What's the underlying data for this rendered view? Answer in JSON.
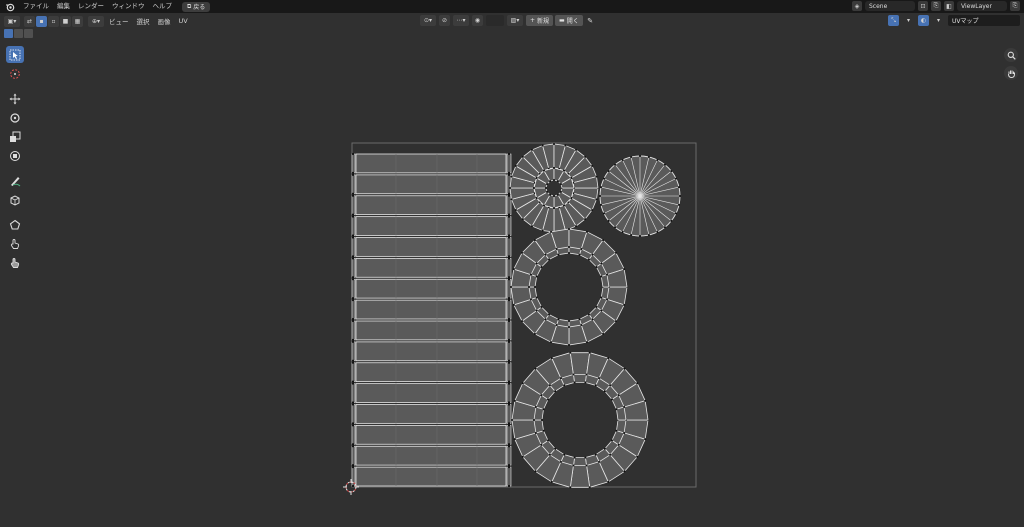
{
  "topbar": {
    "menus": [
      "ファイル",
      "編集",
      "レンダー",
      "ウィンドウ",
      "ヘルプ"
    ],
    "back_label": "戻る",
    "scene_name": "Scene",
    "view_layer": "ViewLayer"
  },
  "header": {
    "menus": [
      "ビュー",
      "選択",
      "画像",
      "UV"
    ],
    "new_label": "新規",
    "open_label": "開く",
    "uv_map": "UVマップ"
  },
  "toolbar": {
    "tools": [
      "select-box",
      "cursor",
      "move",
      "rotate",
      "scale",
      "transform",
      "annotate",
      "annotate-line",
      "rip-region",
      "grab",
      "relax",
      "pinch"
    ]
  },
  "colors": {
    "accent": "#4772b3",
    "background": "#303030",
    "uv_face": "#5a5a5a",
    "uv_edge": "#e6e6e6"
  }
}
